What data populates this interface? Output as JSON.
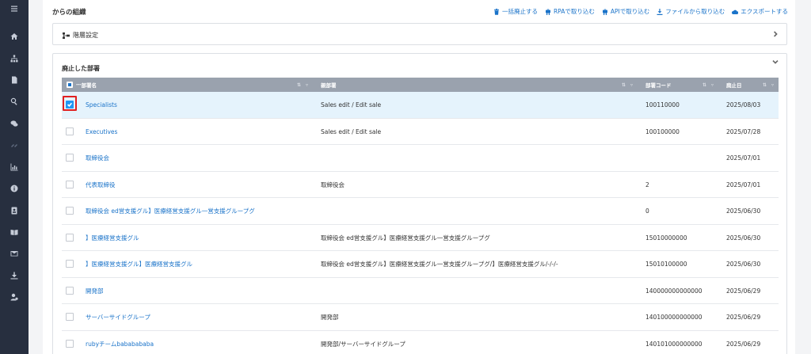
{
  "page": {
    "title": "からの組織"
  },
  "actions": [
    {
      "label": "一括廃止する",
      "icon": "trash-icon"
    },
    {
      "label": "RPAで取り込む",
      "icon": "robot-icon"
    },
    {
      "label": "APIで取り込む",
      "icon": "robot-icon"
    },
    {
      "label": "ファイルから取り込む",
      "icon": "download-icon"
    },
    {
      "label": "エクスポートする",
      "icon": "cloud-upload-icon"
    }
  ],
  "hierarchy_panel": {
    "label": "階層設定"
  },
  "discontinued_panel": {
    "title": "廃止した部署",
    "columns": [
      "部署名",
      "親部署",
      "部署コード",
      "廃止日"
    ],
    "rows": [
      {
        "name": "Specialists",
        "parent": "Sales edit / Edit sale",
        "code": "100110000",
        "date": "2025/08/03",
        "checked": true
      },
      {
        "name": "Executives",
        "parent": "Sales edit / Edit sale",
        "code": "100100000",
        "date": "2025/07/28",
        "checked": false
      },
      {
        "name": "取締役会",
        "parent": "",
        "code": "",
        "date": "2025/07/01",
        "checked": false
      },
      {
        "name": "代表取締役",
        "parent": "取締役会",
        "code": "2",
        "date": "2025/07/01",
        "checked": false
      },
      {
        "name": "取締役会 ed営支援グル】医療経営支援グル一営支援グループグ",
        "parent": "",
        "code": "0",
        "date": "2025/06/30",
        "checked": false
      },
      {
        "name": "】医療経営支援グル",
        "parent": "取締役会 ed営支援グル】医療経営支援グル一営支援グループグ",
        "code": "15010000000",
        "date": "2025/06/30",
        "checked": false
      },
      {
        "name": "】医療経営支援グル】医療経営支援グル",
        "parent": "取締役会 ed営支援グル】医療経営支援グル一営支援グループグ/】医療経営支援グル/-/-/-",
        "code": "15010100000",
        "date": "2025/06/30",
        "checked": false
      },
      {
        "name": "開発部",
        "parent": "",
        "code": "140000000000000",
        "date": "2025/06/29",
        "checked": false
      },
      {
        "name": "サーバーサイドグループ",
        "parent": "開発部",
        "code": "140100000000000",
        "date": "2025/06/29",
        "checked": false
      },
      {
        "name": "rubyチームbababababa",
        "parent": "開発部/サーバーサイドグループ",
        "code": "140101000000000",
        "date": "2025/06/29",
        "checked": false
      }
    ]
  },
  "sidebar": {
    "icons": [
      "menu-icon",
      "home-icon",
      "org-chart-icon",
      "document-icon",
      "search-icon",
      "chat-icon",
      "link-icon",
      "chart-icon",
      "info-icon",
      "contact-card-icon",
      "book-icon",
      "mail-icon",
      "download-icon",
      "user-settings-icon"
    ]
  }
}
